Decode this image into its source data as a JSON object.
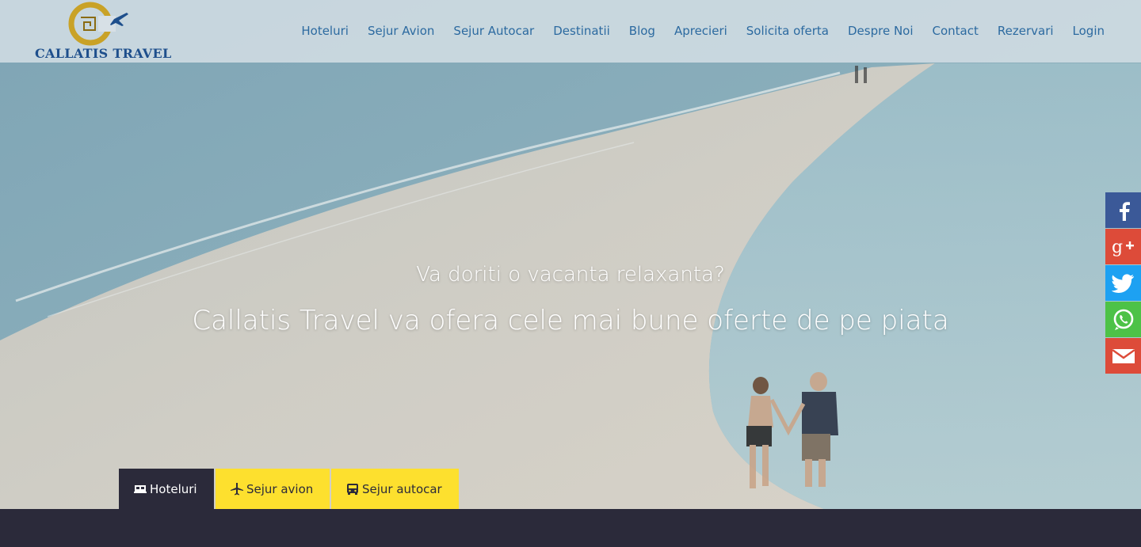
{
  "brand": {
    "name": "CALLATIS TRAVEL",
    "logo_icon": "meander-c-airplane-logo",
    "accent": "#2c6aa0",
    "gold": "#c9a227"
  },
  "nav": {
    "items": [
      {
        "label": "Hoteluri"
      },
      {
        "label": "Sejur Avion"
      },
      {
        "label": "Sejur Autocar"
      },
      {
        "label": "Destinatii"
      },
      {
        "label": "Blog"
      },
      {
        "label": "Aprecieri"
      },
      {
        "label": "Solicita oferta"
      },
      {
        "label": "Despre Noi"
      },
      {
        "label": "Contact"
      },
      {
        "label": "Rezervari"
      },
      {
        "label": "Login"
      }
    ]
  },
  "hero": {
    "headline": "Va doriti o vacanta relaxanta?",
    "subheadline": "Callatis Travel va ofera cele mai bune oferte de pe piata"
  },
  "search_tabs": [
    {
      "label": "Hoteluri",
      "icon": "hotel-bed-icon",
      "active": true,
      "color": "#2b2a3a"
    },
    {
      "label": "Sejur avion",
      "icon": "airplane-icon",
      "active": false,
      "color": "#fde02e"
    },
    {
      "label": "Sejur autocar",
      "icon": "bus-icon",
      "active": false,
      "color": "#fde02e"
    }
  ],
  "social": [
    {
      "network": "facebook",
      "icon": "facebook-icon",
      "color": "#3b5998"
    },
    {
      "network": "google-plus",
      "icon": "google-plus-icon",
      "color": "#dd4b39"
    },
    {
      "network": "twitter",
      "icon": "twitter-icon",
      "color": "#1da1f2"
    },
    {
      "network": "whatsapp",
      "icon": "whatsapp-icon",
      "color": "#4dc247"
    },
    {
      "network": "email",
      "icon": "email-icon",
      "color": "#dd4b39"
    }
  ]
}
